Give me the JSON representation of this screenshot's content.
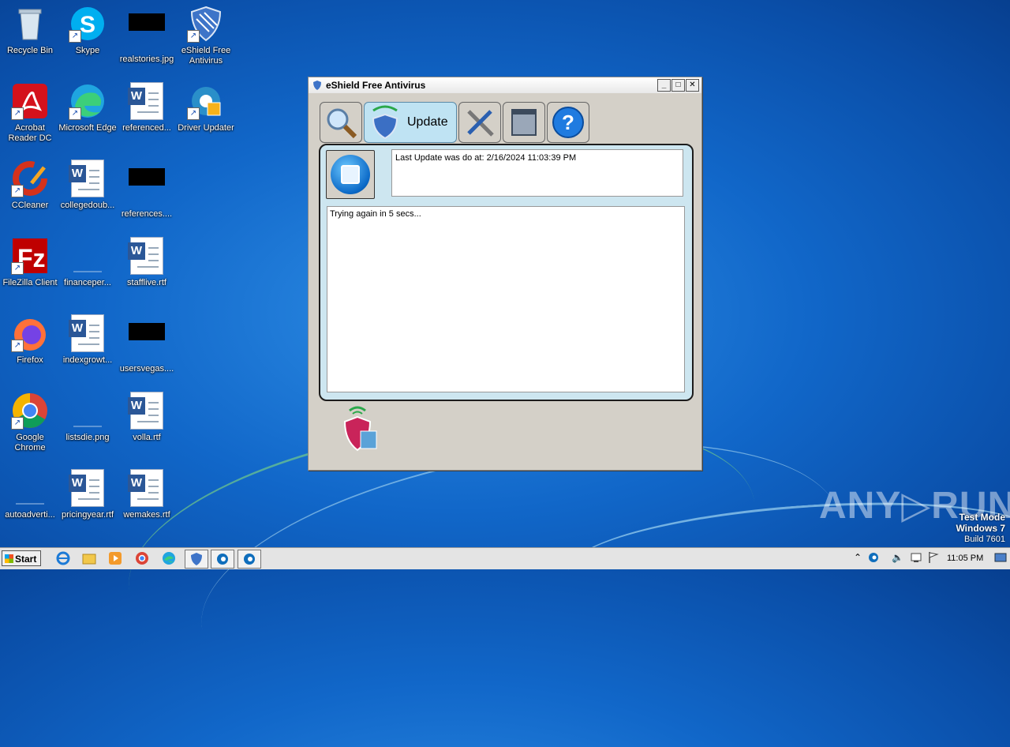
{
  "desktop": {
    "icons": [
      {
        "label": "Recycle Bin"
      },
      {
        "label": "Skype"
      },
      {
        "label": "realstories.jpg"
      },
      {
        "label": "eShield Free Antivirus"
      },
      {
        "label": "Acrobat Reader DC"
      },
      {
        "label": "Microsoft Edge"
      },
      {
        "label": "referenced..."
      },
      {
        "label": "Driver Updater"
      },
      {
        "label": "CCleaner"
      },
      {
        "label": "collegedoub..."
      },
      {
        "label": "references...."
      },
      {
        "label": "FileZilla Client"
      },
      {
        "label": "financeper..."
      },
      {
        "label": "stafflive.rtf"
      },
      {
        "label": "Firefox"
      },
      {
        "label": "indexgrowt..."
      },
      {
        "label": "usersvegas...."
      },
      {
        "label": "Google Chrome"
      },
      {
        "label": "listsdie.png"
      },
      {
        "label": "volla.rtf"
      },
      {
        "label": "autoadverti..."
      },
      {
        "label": "pricingyear.rtf"
      },
      {
        "label": "wemakes.rtf"
      }
    ]
  },
  "window": {
    "title": "eShield Free Antivirus",
    "tabs": {
      "update_label": "Update"
    },
    "last_update": "Last Update was do at: 2/16/2024 11:03:39 PM",
    "log": "Trying again in 5 secs..."
  },
  "watermark": {
    "brand": "ANY▷RUN",
    "mode": "Test Mode",
    "os": "Windows 7",
    "build": "Build 7601"
  },
  "taskbar": {
    "start_label": "Start",
    "clock": "11:05 PM"
  }
}
